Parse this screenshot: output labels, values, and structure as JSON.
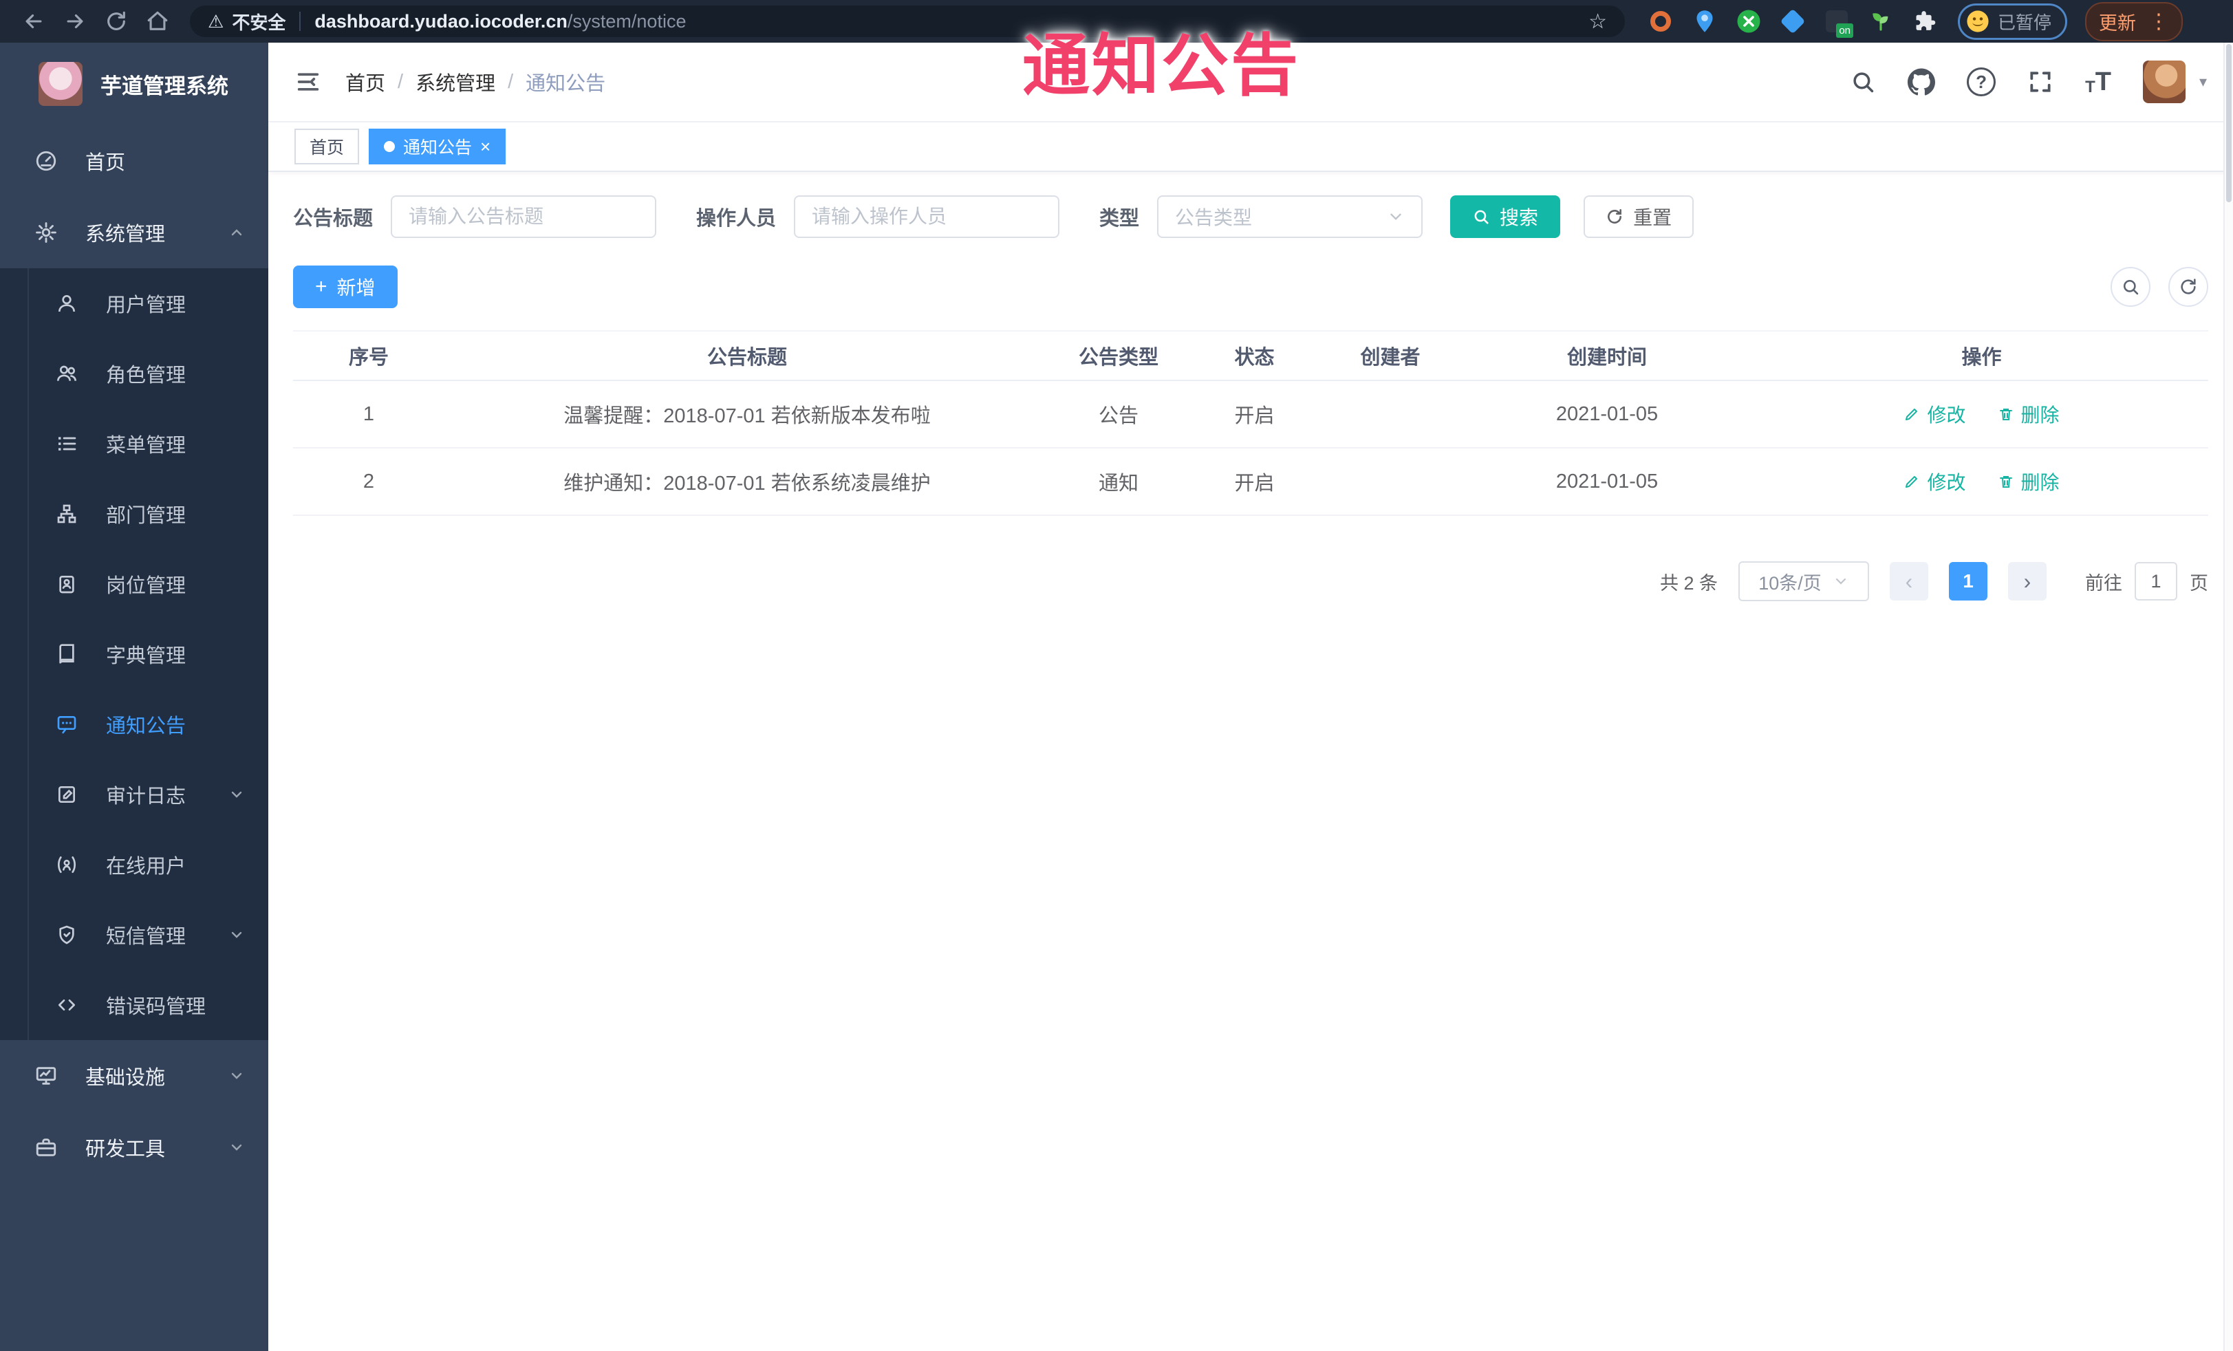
{
  "colors": {
    "primary_blue": "#409eff",
    "teal": "#14b8a6",
    "action_teal": "#17b3a3",
    "overlay_pink": "#f1406a",
    "sidebar_bg": "#334258",
    "submenu_bg": "#212d40",
    "browser_bar_bg": "#1e2836"
  },
  "icons": {
    "back": "←",
    "forward": "→",
    "home": "⌂",
    "warning": "⚠",
    "star": "☆",
    "close": "×",
    "plus": "+",
    "caret_down": "▾",
    "slash": "/",
    "question": "?",
    "prev": "‹",
    "next": "›",
    "kebab": "⋮",
    "font_small": "T",
    "font_big": "T",
    "on_badge": "on"
  },
  "browser": {
    "security_label": "不安全",
    "url_host": "dashboard.yudao.iocoder.cn",
    "url_path": "/system/notice",
    "paused_label": "已暂停",
    "update_label": "更新"
  },
  "overlay": {
    "title": "通知公告"
  },
  "sidebar": {
    "logo_title": "芋道管理系统",
    "items": [
      {
        "label": "首页",
        "icon": "dashboard-icon",
        "level": "top"
      },
      {
        "label": "系统管理",
        "icon": "gear-icon",
        "level": "top",
        "chevron": "up",
        "expanded": true
      },
      {
        "label": "用户管理",
        "icon": "user-icon",
        "level": "sub"
      },
      {
        "label": "角色管理",
        "icon": "users-icon",
        "level": "sub"
      },
      {
        "label": "菜单管理",
        "icon": "menu-list-icon",
        "level": "sub"
      },
      {
        "label": "部门管理",
        "icon": "org-tree-icon",
        "level": "sub"
      },
      {
        "label": "岗位管理",
        "icon": "badge-icon",
        "level": "sub"
      },
      {
        "label": "字典管理",
        "icon": "book-icon",
        "level": "sub"
      },
      {
        "label": "通知公告",
        "icon": "message-icon",
        "level": "sub",
        "active": true
      },
      {
        "label": "审计日志",
        "icon": "edit-log-icon",
        "level": "sub",
        "chevron": "down"
      },
      {
        "label": "在线用户",
        "icon": "online-user-icon",
        "level": "sub"
      },
      {
        "label": "短信管理",
        "icon": "shield-icon",
        "level": "sub",
        "chevron": "down"
      },
      {
        "label": "错误码管理",
        "icon": "code-icon",
        "level": "sub"
      },
      {
        "label": "基础设施",
        "icon": "monitor-icon",
        "level": "top",
        "chevron": "down"
      },
      {
        "label": "研发工具",
        "icon": "briefcase-icon",
        "level": "top",
        "chevron": "down"
      }
    ]
  },
  "header": {
    "breadcrumb": [
      "首页",
      "系统管理",
      "通知公告"
    ]
  },
  "tabs": [
    {
      "label": "首页",
      "active": false
    },
    {
      "label": "通知公告",
      "active": true,
      "closable": true
    }
  ],
  "filters": {
    "title_label": "公告标题",
    "title_placeholder": "请输入公告标题",
    "operator_label": "操作人员",
    "operator_placeholder": "请输入操作人员",
    "type_label": "类型",
    "type_placeholder": "公告类型",
    "search_label": "搜索",
    "reset_label": "重置"
  },
  "toolbar": {
    "add_label": "新增"
  },
  "table": {
    "columns": [
      "序号",
      "公告标题",
      "公告类型",
      "状态",
      "创建者",
      "创建时间",
      "操作"
    ],
    "rows": [
      {
        "seq": "1",
        "title": "温馨提醒：2018-07-01 若依新版本发布啦",
        "type": "公告",
        "status": "开启",
        "creator": "",
        "created": "2021-01-05"
      },
      {
        "seq": "2",
        "title": "维护通知：2018-07-01 若依系统凌晨维护",
        "type": "通知",
        "status": "开启",
        "creator": "",
        "created": "2021-01-05"
      }
    ],
    "edit_label": "修改",
    "delete_label": "删除"
  },
  "pagination": {
    "total": "共 2 条",
    "page_size": "10条/页",
    "current_page": "1",
    "goto_label": "前往",
    "goto_value": "1",
    "unit_label": "页"
  }
}
